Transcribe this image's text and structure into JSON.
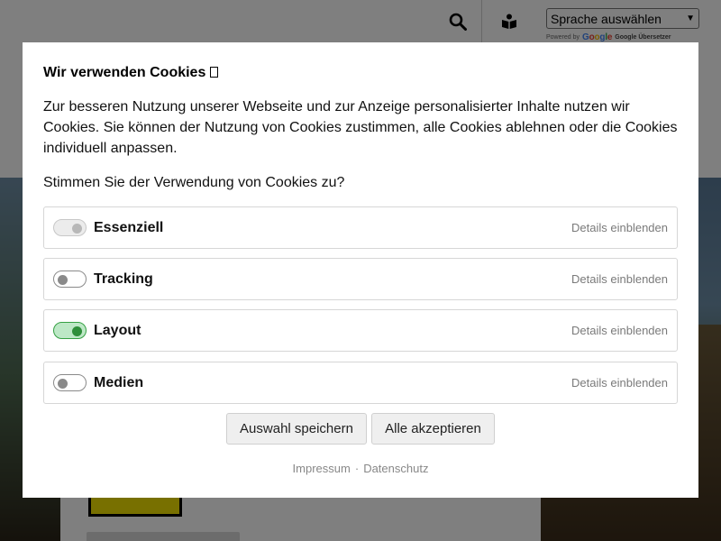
{
  "header": {
    "language_select": {
      "value": "Sprache auswählen"
    },
    "powered_by": {
      "prefix": "Powered by",
      "google": "Google",
      "service": "Google Übersetzer"
    },
    "search_icon": "search-icon",
    "reader_icon": "reader-icon"
  },
  "cookie_dialog": {
    "title": "Wir verwenden Cookies",
    "description": "Zur besseren Nutzung unserer Webseite und zur Anzeige personalisierter Inhalte nutzen wir Cookies. Sie können der Nutzung von Cookies zustimmen, alle Cookies ablehnen oder die Cookies individuell anpassen.",
    "question": "Stimmen Sie der Verwendung von Cookies zu?",
    "categories": [
      {
        "label": "Essenziell",
        "state": "disabled-on",
        "details": "Details einblenden"
      },
      {
        "label": "Tracking",
        "state": "off",
        "details": "Details einblenden"
      },
      {
        "label": "Layout",
        "state": "on",
        "details": "Details einblenden"
      },
      {
        "label": "Medien",
        "state": "off",
        "details": "Details einblenden"
      }
    ],
    "buttons": {
      "save": "Auswahl speichern",
      "accept_all": "Alle akzeptieren"
    },
    "footer": {
      "imprint": "Impressum",
      "separator": "·",
      "privacy": "Datenschutz"
    },
    "colors": {
      "toggle_on": "#2e8f3a",
      "toggle_on_bg": "#bde8c6",
      "toggle_off": "#8a8a8a"
    }
  }
}
